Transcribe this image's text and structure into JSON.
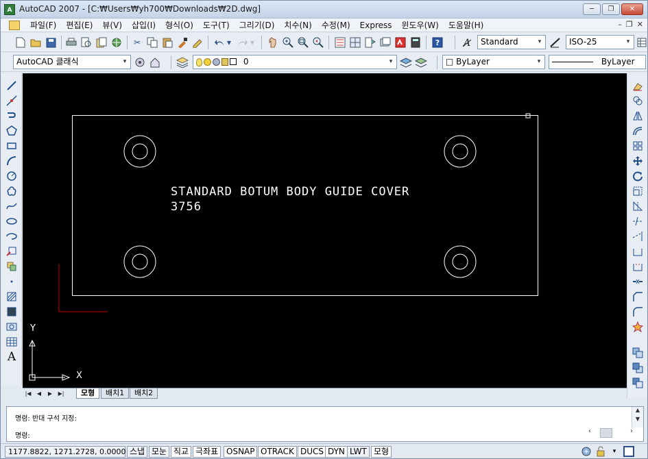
{
  "window": {
    "title": "AutoCAD 2007 - [C:₩Users₩yh700₩Downloads₩2D.dwg]",
    "minimize_label": "─",
    "restore_label": "❐",
    "close_label": "✕"
  },
  "menubar": {
    "items": [
      "파일(F)",
      "편집(E)",
      "뷰(V)",
      "삽입(I)",
      "형식(O)",
      "도구(T)",
      "그리기(D)",
      "치수(N)",
      "수정(M)",
      "Express",
      "윈도우(W)",
      "도움말(H)"
    ],
    "mdi": {
      "minimize": "–",
      "restore": "❐",
      "close": "✕"
    }
  },
  "toolbar1": {
    "text_style_value": "Standard",
    "dim_style_value": "ISO-25"
  },
  "toolbar2": {
    "workspace_value": "AutoCAD 클래식",
    "layer_value": "0",
    "color_value": "□ ByLayer",
    "linetype_value": "ByLayer"
  },
  "drawing": {
    "title_line1": "STANDARD BOTUM BODY GUIDE COVER",
    "title_line2": "3756",
    "ucs_x_label": "X",
    "ucs_y_label": "Y"
  },
  "layout_tabs": {
    "nav": [
      "|◀",
      "◀",
      "▶",
      "▶|"
    ],
    "tabs": [
      "모형",
      "배치1",
      "배치2"
    ],
    "active_tab": "모형"
  },
  "command": {
    "history_line": "명령:  반대  구석  지정:",
    "prompt_line": "명령:"
  },
  "status": {
    "coordinates": "1177.8822, 1271.2728, 0.0000",
    "buttons": [
      {
        "label": "스냅",
        "on": false
      },
      {
        "label": "모눈",
        "on": false
      },
      {
        "label": "직교",
        "on": true
      },
      {
        "label": "극좌표",
        "on": true
      },
      {
        "label": "OSNAP",
        "on": true
      },
      {
        "label": "OTRACK",
        "on": true
      },
      {
        "label": "DUCS",
        "on": true
      },
      {
        "label": "DYN",
        "on": true
      },
      {
        "label": "LWT",
        "on": false
      },
      {
        "label": "모형",
        "on": true
      }
    ]
  },
  "colors": {
    "canvas_bg": "#000000",
    "geometry": "#ffffff",
    "ucs_red": "#cc0000"
  }
}
